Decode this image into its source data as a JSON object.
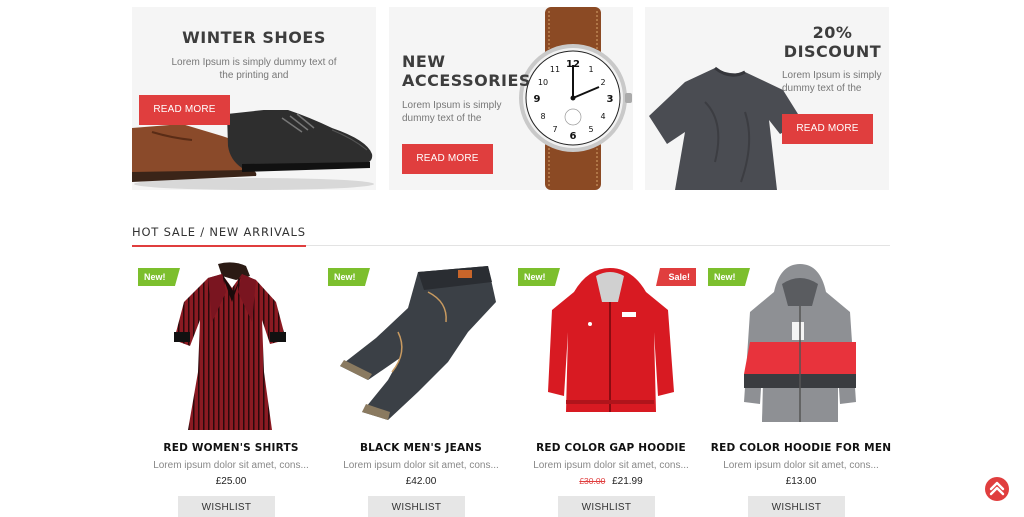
{
  "banners": [
    {
      "title": "WINTER SHOES",
      "text": "Lorem Ipsum is simply dummy text of the printing and",
      "button": "READ MORE"
    },
    {
      "title_line1": "NEW",
      "title_line2": "ACCESSORIES",
      "text": "Lorem Ipsum is simply dummy text of the",
      "button": "READ MORE"
    },
    {
      "title_line1": "20%",
      "title_line2": "DISCOUNT",
      "text": "Lorem Ipsum is simply dummy text of the",
      "button": "READ MORE"
    }
  ],
  "section": {
    "title": "HOT SALE / NEW ARRIVALS"
  },
  "products": [
    {
      "badge": "New!",
      "name": "RED WOMEN'S SHIRTS",
      "desc": "Lorem ipsum dolor sit amet, cons...",
      "price": "£25.00",
      "old_price": "",
      "wishlist": "WISHLIST",
      "image": "red-striped-shirt-image"
    },
    {
      "badge": "New!",
      "name": "BLACK MEN'S JEANS",
      "desc": "Lorem ipsum dolor sit amet, cons...",
      "price": "£42.00",
      "old_price": "",
      "wishlist": "WISHLIST",
      "image": "black-jeans-image"
    },
    {
      "badge": "New!",
      "sale_badge": "Sale!",
      "name": "RED COLOR GAP HOODIE",
      "desc": "Lorem ipsum dolor sit amet, cons...",
      "price": "£21.99",
      "old_price": "£30.00",
      "wishlist": "WISHLIST",
      "image": "red-hoodie-image"
    },
    {
      "badge": "New!",
      "name": "RED COLOR HOODIE FOR MEN",
      "desc": "Lorem ipsum dolor sit amet, cons...",
      "price": "£13.00",
      "old_price": "",
      "wishlist": "WISHLIST",
      "image": "gray-red-hoodie-image"
    }
  ],
  "colors": {
    "accent": "#e03e3e",
    "new_badge": "#7cbf2d",
    "banner_bg": "#f5f5f5",
    "wishlist_bg": "#e6e6e6"
  },
  "icons": {
    "back_to_top": "chevron-up-icon"
  }
}
